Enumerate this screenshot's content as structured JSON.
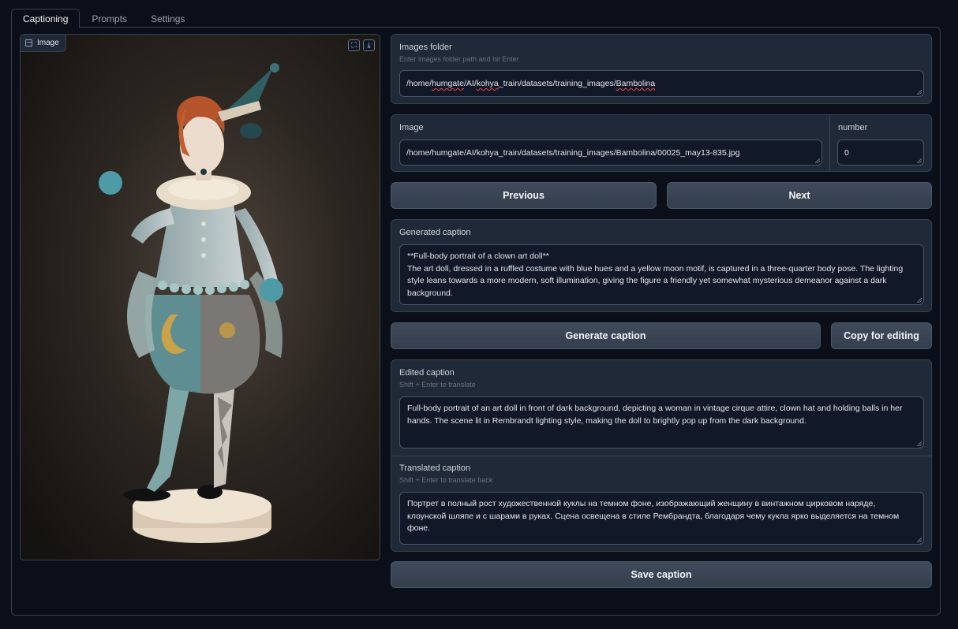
{
  "tabs": [
    {
      "label": "Captioning",
      "active": true
    },
    {
      "label": "Prompts",
      "active": false
    },
    {
      "label": "Settings",
      "active": false
    }
  ],
  "image_panel": {
    "label": "Image",
    "fullscreen_icon": "fullscreen-icon",
    "download_icon": "download-icon"
  },
  "images_folder": {
    "label": "Images folder",
    "hint": "Enter images folder path and hit Enter",
    "value_parts": [
      "/home/",
      "humgate",
      "/AI/",
      "kohya",
      "_train/datasets/training_images/",
      "Bambolina"
    ]
  },
  "image_field": {
    "label": "Image",
    "value": "/home/humgate/AI/kohya_train/datasets/training_images/Bambolina/00025_may13-835.jpg"
  },
  "number_field": {
    "label": "number",
    "value": "0"
  },
  "nav": {
    "previous": "Previous",
    "next": "Next"
  },
  "generated_caption": {
    "label": "Generated caption",
    "value": "**Full-body portrait of a clown art doll**\nThe art doll, dressed in a ruffled costume with blue hues and a yellow moon motif, is captured in a three-quarter body pose. The lighting style leans towards a more modern, soft illumination, giving the figure a friendly yet somewhat mysterious demeanor against a dark background."
  },
  "actions": {
    "generate": "Generate caption",
    "copy": "Copy for editing",
    "save": "Save caption"
  },
  "edited_caption": {
    "label": "Edited caption",
    "hint": "Shift + Enter to translate",
    "value": "Full-body portrait of an art doll in front of dark background, depicting a woman in vintage cirque attire, clown hat and holding balls in her hands. The scene lit in Rembrandt lighting style, making the doll to brightly pop up from the dark background."
  },
  "translated_caption": {
    "label": "Translated caption",
    "hint": "Shift + Enter to translate back",
    "value": "Портрет в полный рост художественной куклы на темном фоне, изображающий женщину в винтажном цирковом наряде, клоунской шляпе и с шарами в руках. Сцена освещена в стиле Рембрандта, благодаря чему кукла ярко выделяется на темном фоне."
  },
  "colors": {
    "background": "#0b0f19",
    "panel": "#1f2937",
    "border": "#374151",
    "input": "#111827",
    "button": "#374151"
  }
}
